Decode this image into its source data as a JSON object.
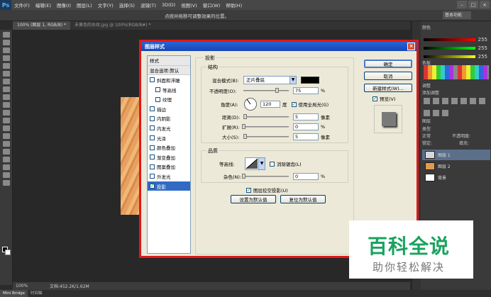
{
  "menu": {
    "logo": "Ps",
    "items": [
      "文件(F)",
      "编辑(E)",
      "图像(I)",
      "图层(L)",
      "文字(Y)",
      "选择(S)",
      "滤镜(T)",
      "3D(D)",
      "视图(V)",
      "窗口(W)",
      "帮助(H)"
    ]
  },
  "options_bar": {
    "hint": "点按并拖移可调整效果的位置。",
    "workspace": "基本功能"
  },
  "tabs": [
    {
      "label": "100% (图层 1, RGB/8) *",
      "active": true
    },
    {
      "label": "未黄色的水纹.jpg @ 100%(RGB/8#) *",
      "active": false
    }
  ],
  "status": {
    "zoom": "100%",
    "doc": "文档:452.2K/1.62M"
  },
  "bottom_tabs": [
    "Mini Bridge",
    "时间轴"
  ],
  "panels": {
    "color_tab": "颜色",
    "swatches_tab": "色板",
    "adjust_tab": "调整",
    "adjust_hint": "添加调整",
    "layers_tab": "图层",
    "kind": "类型",
    "blend": "正常",
    "opacity_label": "不透明度:",
    "lock": "锁定:",
    "fill_label": "填充:",
    "slider_values": [
      "255",
      "255",
      "255"
    ],
    "layers": [
      {
        "name": "图层 1",
        "selected": true,
        "thumb": "#d8d8d8"
      },
      {
        "name": "图层 2",
        "selected": false,
        "thumb": "#e39a4e"
      },
      {
        "name": "背景",
        "selected": false,
        "thumb": "#ffffff"
      }
    ]
  },
  "dialog": {
    "title": "图层样式",
    "close": "×",
    "style_list": [
      {
        "label": "样式",
        "type": "header"
      },
      {
        "label": "混合选项:默认",
        "type": "header"
      },
      {
        "label": "斜面和浮雕",
        "type": "check",
        "checked": false
      },
      {
        "label": "等高线",
        "type": "subcheck",
        "checked": false
      },
      {
        "label": "纹理",
        "type": "subcheck",
        "checked": false
      },
      {
        "label": "描边",
        "type": "check",
        "checked": false
      },
      {
        "label": "内阴影",
        "type": "check",
        "checked": false
      },
      {
        "label": "内发光",
        "type": "check",
        "checked": false
      },
      {
        "label": "光泽",
        "type": "check",
        "checked": false
      },
      {
        "label": "颜色叠加",
        "type": "check",
        "checked": false
      },
      {
        "label": "渐变叠加",
        "type": "check",
        "checked": false
      },
      {
        "label": "图案叠加",
        "type": "check",
        "checked": false
      },
      {
        "label": "外发光",
        "type": "check",
        "checked": false
      },
      {
        "label": "投影",
        "type": "check",
        "checked": true,
        "selected": true
      }
    ],
    "section_title": "投影",
    "structure": {
      "legend": "结构",
      "blend_mode_label": "混合模式(B):",
      "blend_mode_value": "正片叠底",
      "shadow_color": "#000000",
      "opacity_label": "不透明度(O):",
      "opacity_value": "75",
      "opacity_unit": "%",
      "opacity_pct": 75,
      "angle_label": "角度(A):",
      "angle_value": "120",
      "angle_unit": "度",
      "global_light_label": "使用全局光(G)",
      "global_light_checked": true,
      "distance_label": "距离(D):",
      "distance_value": "5",
      "distance_unit": "像素",
      "spread_label": "扩展(R):",
      "spread_value": "0",
      "spread_unit": "%",
      "size_label": "大小(S):",
      "size_value": "5",
      "size_unit": "像素"
    },
    "quality": {
      "legend": "品质",
      "contour_label": "等高线:",
      "anti_alias_label": "消除锯齿(L)",
      "noise_label": "杂色(N):",
      "noise_value": "0",
      "noise_unit": "%"
    },
    "knockout_label": "图层挖空投影(U)",
    "make_default": "设置为默认值",
    "reset_default": "复位为默认值",
    "buttons": {
      "ok": "确定",
      "cancel": "取消",
      "new_style": "新建样式(W)...",
      "preview": "预览(V)"
    }
  },
  "watermark": {
    "main": "百科全说",
    "sub": "助你轻松解决"
  }
}
